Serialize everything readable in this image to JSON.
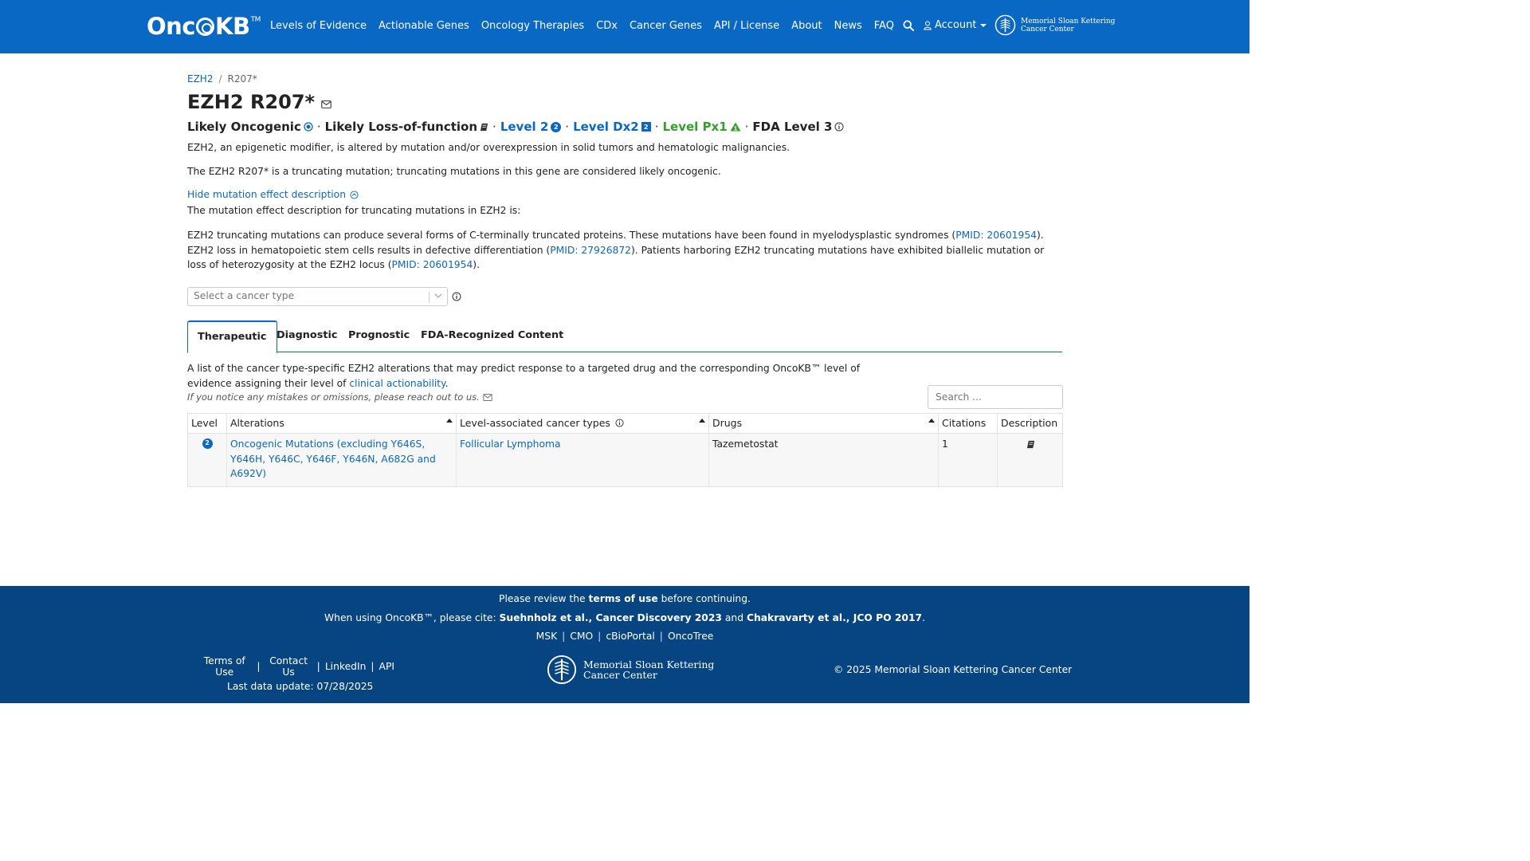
{
  "navbar": {
    "logo_text_a": "Onc",
    "logo_text_b": "KB",
    "logo_tm": "TM",
    "links": [
      "Levels of Evidence",
      "Actionable Genes",
      "Oncology Therapies",
      "CDx",
      "Cancer Genes",
      "API / License",
      "About",
      "News",
      "FAQ"
    ],
    "account_label": "Account",
    "msk_line1": "Memorial Sloan Kettering",
    "msk_line2": "Cancer Center"
  },
  "breadcrumb": {
    "gene": "EZH2",
    "separator": "/",
    "current": "R207*"
  },
  "title": "EZH2 R207*",
  "badges": {
    "oncogenic": "Likely Oncogenic",
    "effect": "Likely Loss-of-function",
    "level": "Level 2",
    "level_badge": "2",
    "dx": "Level Dx2",
    "dx_badge": "2",
    "px": "Level Px1",
    "fda": "FDA Level 3",
    "separator": "·"
  },
  "colors": {
    "brand": "#0968c3",
    "footer": "#064482",
    "green": "#33a02c"
  },
  "gene_summary": "EZH2, an epigenetic modifier, is altered by mutation and/or overexpression in solid tumors and hematologic malignancies.",
  "variant_summary": "The EZH2 R207* is a truncating mutation; truncating mutations in this gene are considered likely oncogenic.",
  "toggle_label": "Hide mutation effect description",
  "effect_intro": "The mutation effect description for truncating mutations in EZH2 is:",
  "effect_desc": {
    "p1": "EZH2 truncating mutations can produce several forms of C-terminally truncated proteins. These mutations have been found in myelodysplastic syndromes (",
    "pmid1": "PMID: 20601954",
    "p2": "). EZH2 loss in hematopoietic stem cells results in defective differentiation (",
    "pmid2": "PMID: 27926872",
    "p3": "). Patients harboring EZH2 truncating mutations have exhibited biallelic mutation or loss of heterozygosity at the EZH2 locus (",
    "pmid3": "PMID: 20601954",
    "p4": ")."
  },
  "cancer_select": {
    "placeholder": "Select a cancer type"
  },
  "tabs": [
    "Therapeutic",
    "Diagnostic",
    "Prognostic",
    "FDA-Recognized Content"
  ],
  "therapeutic": {
    "desc_a": "A list of the cancer type-specific EZH2 alterations that may predict response to a targeted drug and the corresponding OncoKB™ level of evidence assigning their level of ",
    "desc_link": "clinical actionability",
    "desc_b": ".",
    "note": "If you notice any mistakes or omissions, please reach out to us.",
    "search_placeholder": "Search ..."
  },
  "table": {
    "headers": [
      "Level",
      "Alterations",
      "Level-associated cancer types",
      "Drugs",
      "Citations",
      "Description"
    ],
    "rows": [
      {
        "level": "2",
        "alteration": "Oncogenic Mutations (excluding Y646S, Y646H, Y646C, Y646F, Y646N, A682G and A692V)",
        "cancer_type": "Follicular Lymphoma",
        "drugs": "Tazemetostat",
        "citations": "1"
      }
    ]
  },
  "footer": {
    "review_a": "Please review the ",
    "review_b": "terms of use",
    "review_c": " before continuing.",
    "cite_a": "When using OncoKB™, please cite: ",
    "cite_b": "Suehnholz et al., Cancer Discovery 2023",
    "cite_c": " and ",
    "cite_d": "Chakravarty et al., JCO PO 2017",
    "cite_e": ".",
    "links": [
      "MSK",
      "CMO",
      "cBioPortal",
      "OncoTree"
    ],
    "left_links": [
      "Terms of Use",
      "Contact Us",
      "LinkedIn",
      "API"
    ],
    "last_update": "Last data update: 07/28/2025",
    "msk_line1": "Memorial Sloan Kettering",
    "msk_line2": "Cancer Center",
    "copyright": "© 2025 Memorial Sloan Kettering Cancer Center",
    "bar": "|"
  }
}
